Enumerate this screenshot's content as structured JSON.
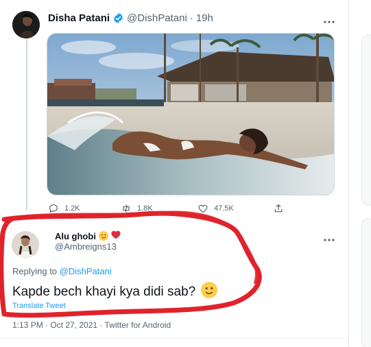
{
  "tweet": {
    "author_name": "Disha Patani",
    "author_handle": "@DishPatani",
    "time_sep": "·",
    "time": "19h",
    "more_icon": "more-icon",
    "actions": {
      "reply_count": "1.2K",
      "retweet_count": "1.8K",
      "like_count": "47.5K"
    }
  },
  "reply": {
    "author_name": "Alu ghobi",
    "author_handle": "@Ambreigns13",
    "replying_prefix": "Replying to",
    "replying_to": "@DishPatani",
    "text": "Kapde bech khayi kya didi sab?",
    "translate_label": "Translate Tweet",
    "timestamp": "1:13 PM · Oct 27, 2021 · Twitter for Android"
  },
  "colors": {
    "accent": "#1d9bf0",
    "secondary_text": "#536471",
    "annotation_red": "#e0232b"
  }
}
